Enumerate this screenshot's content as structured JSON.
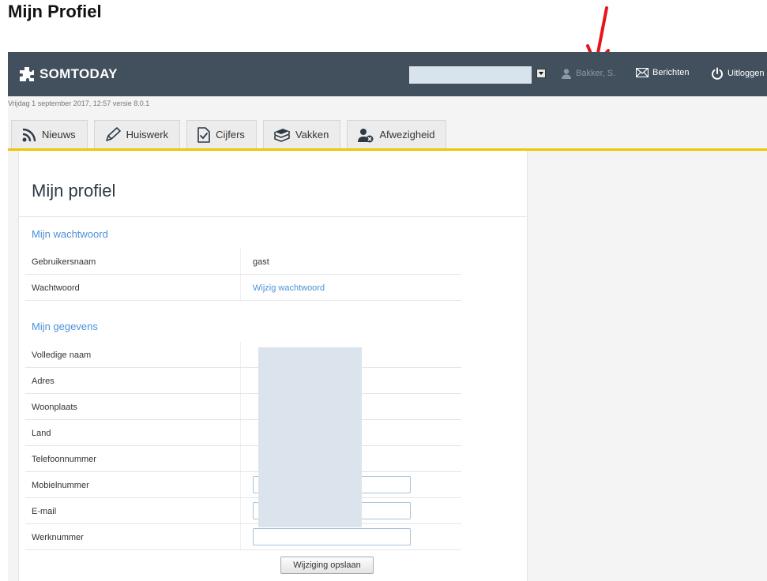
{
  "doc_title": "Mijn Profiel",
  "header": {
    "logo_text": "SOMTODAY",
    "user_name": "Bakker, S.",
    "messages_label": "Berichten",
    "logout_label": "Uitloggen"
  },
  "dateline": "Vrijdag 1 september 2017, 12:57 versie 8.0.1",
  "tabs": [
    {
      "label": "Nieuws"
    },
    {
      "label": "Huiswerk"
    },
    {
      "label": "Cijfers"
    },
    {
      "label": "Vakken"
    },
    {
      "label": "Afwezigheid"
    }
  ],
  "profile": {
    "title": "Mijn profiel",
    "password_section": {
      "title": "Mijn wachtwoord",
      "username_label": "Gebruikersnaam",
      "username_value": "gast",
      "password_label": "Wachtwoord",
      "password_link": "Wijzig wachtwoord"
    },
    "details_section": {
      "title": "Mijn gegevens",
      "fields": [
        {
          "label": "Volledige naam"
        },
        {
          "label": "Adres"
        },
        {
          "label": "Woonplaats"
        },
        {
          "label": "Land"
        },
        {
          "label": "Telefoonnummer"
        },
        {
          "label": "Mobielnummer"
        },
        {
          "label": "E-mail"
        },
        {
          "label": "Werknummer"
        }
      ]
    },
    "save_label": "Wijziging opslaan"
  },
  "colors": {
    "topbar": "#42505e",
    "accent_yellow": "#f2c500",
    "link_blue": "#4a90d9",
    "annotation_arrow": "#e8141c"
  }
}
